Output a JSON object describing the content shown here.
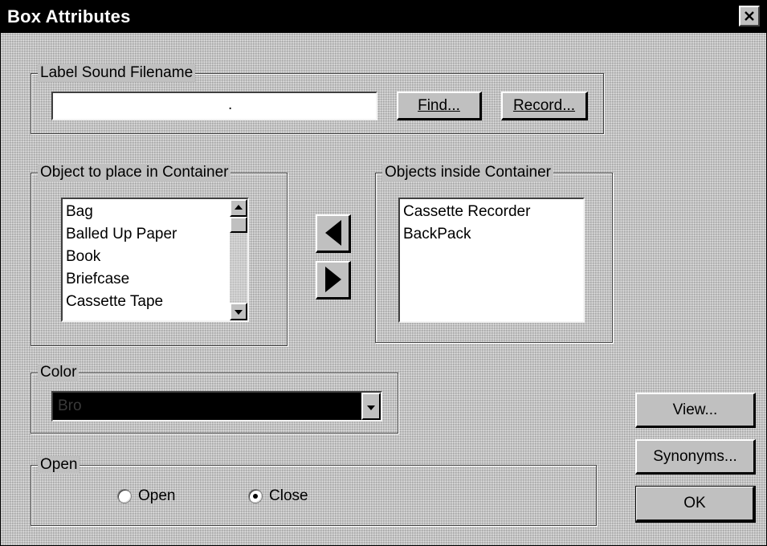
{
  "window": {
    "title": "Box Attributes"
  },
  "sound": {
    "group_label": "Label Sound Filename",
    "filename_value": ".",
    "find_label": "Find...",
    "record_label": "Record..."
  },
  "available": {
    "group_label": "Object to place in Container",
    "items": [
      "Bag",
      "Balled Up Paper",
      "Book",
      "Briefcase",
      "Cassette Tape"
    ]
  },
  "inside": {
    "group_label": "Objects inside Container",
    "items": [
      "Cassette Recorder",
      "BackPack"
    ]
  },
  "color": {
    "group_label": "Color",
    "selected_value": "Bro"
  },
  "open_state": {
    "group_label": "Open",
    "open_label": "Open",
    "close_label": "Close",
    "selected": "Close"
  },
  "actions": {
    "view_label": "View...",
    "synonyms_label": "Synonyms...",
    "ok_label": "OK"
  },
  "icons": {
    "close": "close-icon",
    "move_left": "arrow-left-icon",
    "move_right": "arrow-right-icon",
    "scroll_up": "scroll-up-icon",
    "scroll_down": "scroll-down-icon",
    "dropdown": "chevron-down-icon"
  }
}
